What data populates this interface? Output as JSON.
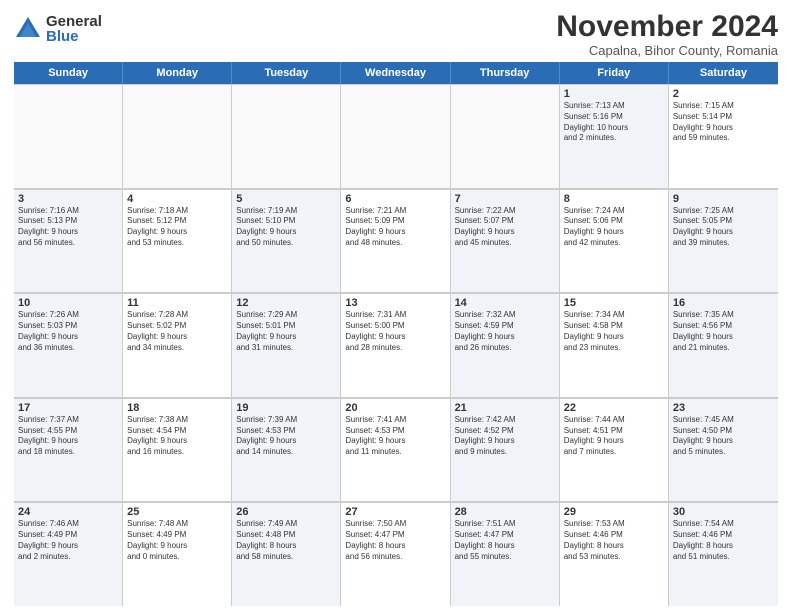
{
  "logo": {
    "general": "General",
    "blue": "Blue"
  },
  "title": "November 2024",
  "subtitle": "Capalna, Bihor County, Romania",
  "days": [
    "Sunday",
    "Monday",
    "Tuesday",
    "Wednesday",
    "Thursday",
    "Friday",
    "Saturday"
  ],
  "weeks": [
    [
      {
        "num": "",
        "text": "",
        "empty": true
      },
      {
        "num": "",
        "text": "",
        "empty": true
      },
      {
        "num": "",
        "text": "",
        "empty": true
      },
      {
        "num": "",
        "text": "",
        "empty": true
      },
      {
        "num": "",
        "text": "",
        "empty": true
      },
      {
        "num": "1",
        "text": "Sunrise: 7:13 AM\nSunset: 5:16 PM\nDaylight: 10 hours\nand 2 minutes.",
        "empty": false,
        "shaded": true
      },
      {
        "num": "2",
        "text": "Sunrise: 7:15 AM\nSunset: 5:14 PM\nDaylight: 9 hours\nand 59 minutes.",
        "empty": false
      }
    ],
    [
      {
        "num": "3",
        "text": "Sunrise: 7:16 AM\nSunset: 5:13 PM\nDaylight: 9 hours\nand 56 minutes.",
        "empty": false,
        "shaded": true
      },
      {
        "num": "4",
        "text": "Sunrise: 7:18 AM\nSunset: 5:12 PM\nDaylight: 9 hours\nand 53 minutes.",
        "empty": false
      },
      {
        "num": "5",
        "text": "Sunrise: 7:19 AM\nSunset: 5:10 PM\nDaylight: 9 hours\nand 50 minutes.",
        "empty": false,
        "shaded": true
      },
      {
        "num": "6",
        "text": "Sunrise: 7:21 AM\nSunset: 5:09 PM\nDaylight: 9 hours\nand 48 minutes.",
        "empty": false
      },
      {
        "num": "7",
        "text": "Sunrise: 7:22 AM\nSunset: 5:07 PM\nDaylight: 9 hours\nand 45 minutes.",
        "empty": false,
        "shaded": true
      },
      {
        "num": "8",
        "text": "Sunrise: 7:24 AM\nSunset: 5:06 PM\nDaylight: 9 hours\nand 42 minutes.",
        "empty": false
      },
      {
        "num": "9",
        "text": "Sunrise: 7:25 AM\nSunset: 5:05 PM\nDaylight: 9 hours\nand 39 minutes.",
        "empty": false,
        "shaded": true
      }
    ],
    [
      {
        "num": "10",
        "text": "Sunrise: 7:26 AM\nSunset: 5:03 PM\nDaylight: 9 hours\nand 36 minutes.",
        "empty": false,
        "shaded": true
      },
      {
        "num": "11",
        "text": "Sunrise: 7:28 AM\nSunset: 5:02 PM\nDaylight: 9 hours\nand 34 minutes.",
        "empty": false
      },
      {
        "num": "12",
        "text": "Sunrise: 7:29 AM\nSunset: 5:01 PM\nDaylight: 9 hours\nand 31 minutes.",
        "empty": false,
        "shaded": true
      },
      {
        "num": "13",
        "text": "Sunrise: 7:31 AM\nSunset: 5:00 PM\nDaylight: 9 hours\nand 28 minutes.",
        "empty": false
      },
      {
        "num": "14",
        "text": "Sunrise: 7:32 AM\nSunset: 4:59 PM\nDaylight: 9 hours\nand 26 minutes.",
        "empty": false,
        "shaded": true
      },
      {
        "num": "15",
        "text": "Sunrise: 7:34 AM\nSunset: 4:58 PM\nDaylight: 9 hours\nand 23 minutes.",
        "empty": false
      },
      {
        "num": "16",
        "text": "Sunrise: 7:35 AM\nSunset: 4:56 PM\nDaylight: 9 hours\nand 21 minutes.",
        "empty": false,
        "shaded": true
      }
    ],
    [
      {
        "num": "17",
        "text": "Sunrise: 7:37 AM\nSunset: 4:55 PM\nDaylight: 9 hours\nand 18 minutes.",
        "empty": false,
        "shaded": true
      },
      {
        "num": "18",
        "text": "Sunrise: 7:38 AM\nSunset: 4:54 PM\nDaylight: 9 hours\nand 16 minutes.",
        "empty": false
      },
      {
        "num": "19",
        "text": "Sunrise: 7:39 AM\nSunset: 4:53 PM\nDaylight: 9 hours\nand 14 minutes.",
        "empty": false,
        "shaded": true
      },
      {
        "num": "20",
        "text": "Sunrise: 7:41 AM\nSunset: 4:53 PM\nDaylight: 9 hours\nand 11 minutes.",
        "empty": false
      },
      {
        "num": "21",
        "text": "Sunrise: 7:42 AM\nSunset: 4:52 PM\nDaylight: 9 hours\nand 9 minutes.",
        "empty": false,
        "shaded": true
      },
      {
        "num": "22",
        "text": "Sunrise: 7:44 AM\nSunset: 4:51 PM\nDaylight: 9 hours\nand 7 minutes.",
        "empty": false
      },
      {
        "num": "23",
        "text": "Sunrise: 7:45 AM\nSunset: 4:50 PM\nDaylight: 9 hours\nand 5 minutes.",
        "empty": false,
        "shaded": true
      }
    ],
    [
      {
        "num": "24",
        "text": "Sunrise: 7:46 AM\nSunset: 4:49 PM\nDaylight: 9 hours\nand 2 minutes.",
        "empty": false,
        "shaded": true
      },
      {
        "num": "25",
        "text": "Sunrise: 7:48 AM\nSunset: 4:49 PM\nDaylight: 9 hours\nand 0 minutes.",
        "empty": false
      },
      {
        "num": "26",
        "text": "Sunrise: 7:49 AM\nSunset: 4:48 PM\nDaylight: 8 hours\nand 58 minutes.",
        "empty": false,
        "shaded": true
      },
      {
        "num": "27",
        "text": "Sunrise: 7:50 AM\nSunset: 4:47 PM\nDaylight: 8 hours\nand 56 minutes.",
        "empty": false
      },
      {
        "num": "28",
        "text": "Sunrise: 7:51 AM\nSunset: 4:47 PM\nDaylight: 8 hours\nand 55 minutes.",
        "empty": false,
        "shaded": true
      },
      {
        "num": "29",
        "text": "Sunrise: 7:53 AM\nSunset: 4:46 PM\nDaylight: 8 hours\nand 53 minutes.",
        "empty": false
      },
      {
        "num": "30",
        "text": "Sunrise: 7:54 AM\nSunset: 4:46 PM\nDaylight: 8 hours\nand 51 minutes.",
        "empty": false,
        "shaded": true
      }
    ]
  ]
}
